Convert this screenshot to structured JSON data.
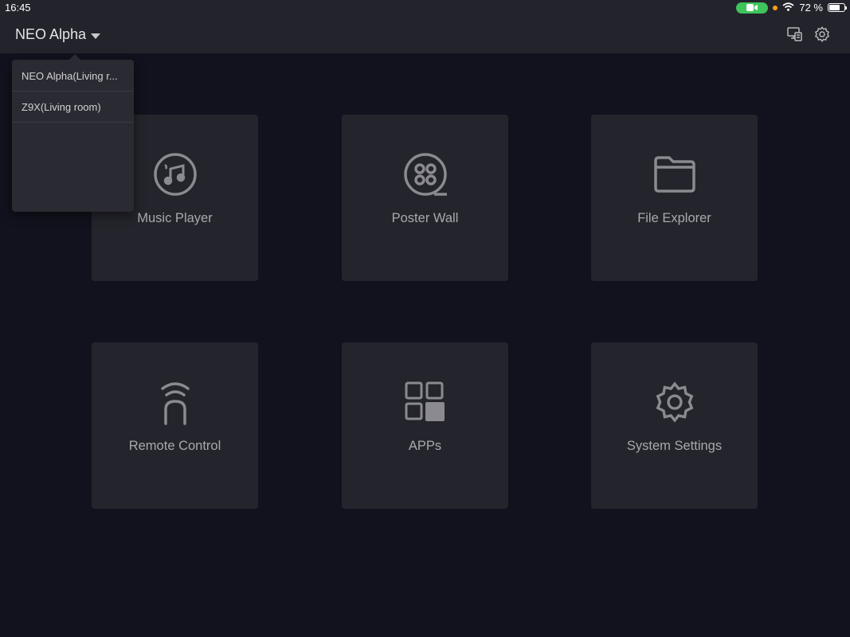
{
  "status_bar": {
    "time": "16:45",
    "battery_text": "72 %",
    "battery_level": 0.72,
    "icons": [
      "camera-in-use-icon",
      "recording-dot-icon",
      "wifi-icon",
      "battery-icon"
    ]
  },
  "header": {
    "device_name": "NEO Alpha",
    "icons": [
      "screen-cast-icon",
      "gear-icon"
    ]
  },
  "dropdown": {
    "items": [
      {
        "label": "NEO Alpha(Living r..."
      },
      {
        "label": "Z9X(Living room)"
      }
    ]
  },
  "tiles": [
    {
      "label": "Music Player",
      "icon": "music-icon"
    },
    {
      "label": "Poster Wall",
      "icon": "film-reel-icon"
    },
    {
      "label": "File Explorer",
      "icon": "folder-icon"
    },
    {
      "label": "Remote Control",
      "icon": "remote-icon"
    },
    {
      "label": "APPs",
      "icon": "apps-grid-icon"
    },
    {
      "label": "System Settings",
      "icon": "gear-icon"
    }
  ],
  "colors": {
    "background": "#12121e",
    "bar": "#23232b",
    "tile": "#24242c",
    "icon": "#8a8a90",
    "camera_pill": "#3fc35b",
    "recording_dot": "#ff9f0a"
  }
}
